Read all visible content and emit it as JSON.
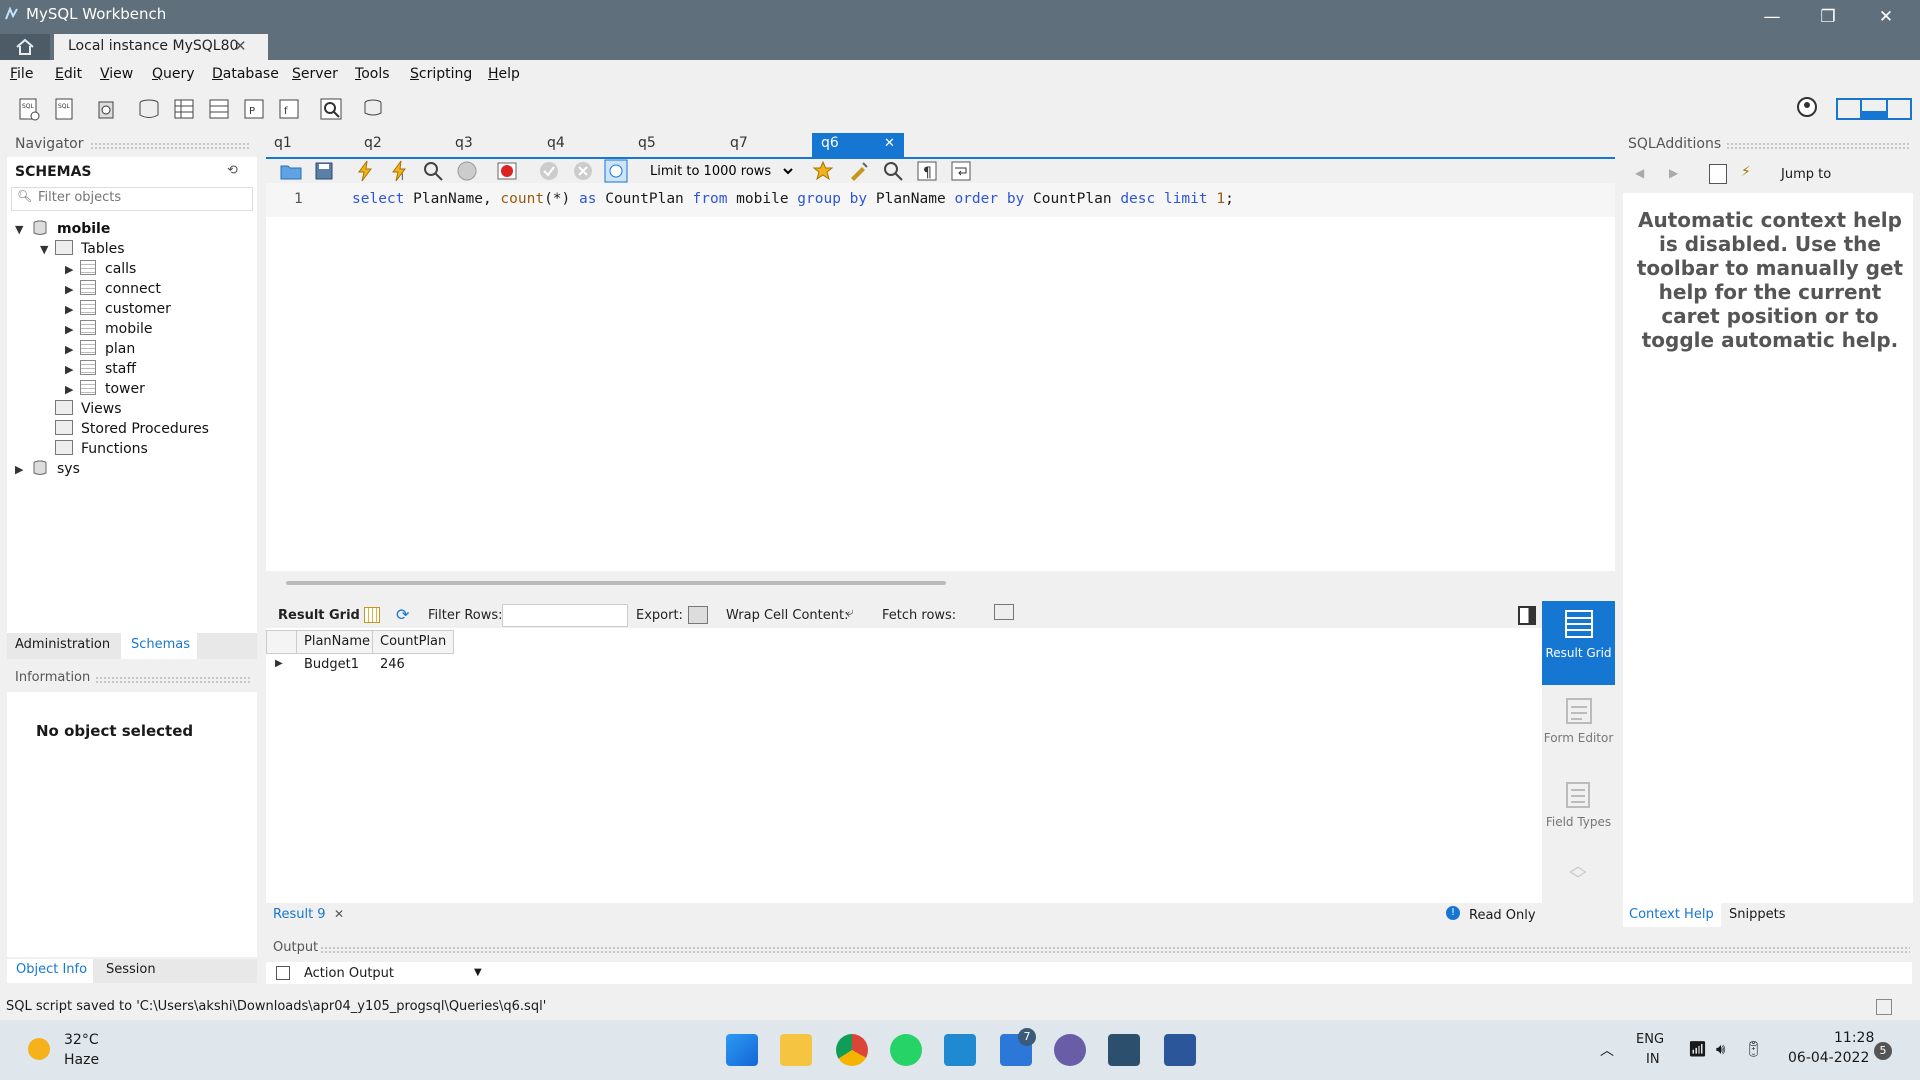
{
  "window": {
    "title": "MySQL Workbench",
    "connection_tab": "Local instance MySQL80",
    "controls": {
      "minimize": "—",
      "restore": "❐",
      "close": "✕"
    }
  },
  "menu": [
    "File",
    "Edit",
    "View",
    "Query",
    "Database",
    "Server",
    "Tools",
    "Scripting",
    "Help"
  ],
  "navigator": {
    "header": "Navigator",
    "schemas_label": "SCHEMAS",
    "filter_placeholder": "Filter objects",
    "schema_mobile": "mobile",
    "tables_label": "Tables",
    "tables": [
      "calls",
      "connect",
      "customer",
      "mobile",
      "plan",
      "staff",
      "tower"
    ],
    "views_label": "Views",
    "procedures_label": "Stored Procedures",
    "functions_label": "Functions",
    "schema_sys": "sys",
    "tab_admin": "Administration",
    "tab_schemas": "Schemas",
    "info_header": "Information",
    "no_object": "No object selected",
    "tab_objinfo": "Object Info",
    "tab_session": "Session"
  },
  "query_tabs": [
    "q1",
    "q2",
    "q3",
    "q4",
    "q5",
    "q7",
    "q6"
  ],
  "active_tab": "q6",
  "editor_toolbar": {
    "limit": "Limit to 1000 rows"
  },
  "editor": {
    "line_number": "1",
    "tokens": [
      {
        "t": "select",
        "c": "kw"
      },
      {
        "t": " PlanName, ",
        "c": ""
      },
      {
        "t": "count",
        "c": "fn"
      },
      {
        "t": "(*)",
        "c": ""
      },
      {
        "t": " as",
        "c": "kw"
      },
      {
        "t": " CountPlan ",
        "c": ""
      },
      {
        "t": "from",
        "c": "kw"
      },
      {
        "t": " mobile ",
        "c": ""
      },
      {
        "t": "group by",
        "c": "kw"
      },
      {
        "t": " PlanName ",
        "c": ""
      },
      {
        "t": "order by",
        "c": "kw"
      },
      {
        "t": " CountPlan ",
        "c": ""
      },
      {
        "t": "desc",
        "c": "kw"
      },
      {
        "t": " ",
        "c": ""
      },
      {
        "t": "limit",
        "c": "kw"
      },
      {
        "t": " ",
        "c": ""
      },
      {
        "t": "1",
        "c": "fn"
      },
      {
        "t": ";",
        "c": ""
      }
    ]
  },
  "result_toolbar": {
    "result_grid": "Result Grid",
    "filter_rows": "Filter Rows:",
    "export": "Export:",
    "wrap": "Wrap Cell Content:",
    "fetch": "Fetch rows:"
  },
  "result_grid": {
    "columns": [
      "PlanName",
      "CountPlan"
    ],
    "rows": [
      [
        "Budget1",
        "246"
      ]
    ]
  },
  "result_footer": {
    "tab": "Result 9",
    "readonly": "Read Only"
  },
  "side_buttons": {
    "result_grid": "Result Grid",
    "form_editor": "Form Editor",
    "field_types": "Field Types"
  },
  "sql_additions": {
    "header": "SQLAdditions",
    "jump_to": "Jump to",
    "help_text": "Automatic context help is disabled. Use the toolbar to manually get help for the current caret position or to toggle automatic help.",
    "tab_context": "Context Help",
    "tab_snippets": "Snippets"
  },
  "output": {
    "header": "Output",
    "selector": "Action Output"
  },
  "status_bar": "SQL script saved to 'C:\\Users\\akshi\\Downloads\\apr04_y105_progsql\\Queries\\q6.sql'",
  "taskbar": {
    "weather_temp": "32°C",
    "weather_desc": "Haze",
    "lang1": "ENG",
    "lang2": "IN",
    "time": "11:28",
    "date": "06-04-2022",
    "badge": "5",
    "mail_badge": "7"
  },
  "colors": {
    "accent": "#1677d2",
    "titlebar": "#5f6f7b",
    "keyword": "#2f56d6"
  }
}
